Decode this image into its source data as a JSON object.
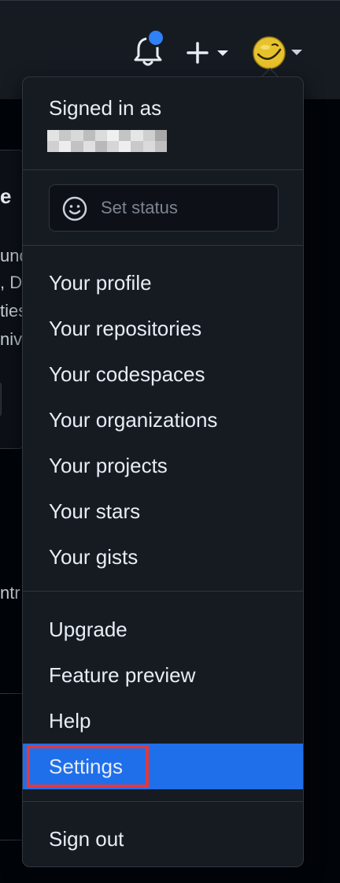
{
  "header": {
    "bell_icon": "bell-icon",
    "notification_indicator": "unread-dot",
    "create_icon": "plus-icon",
    "avatar_icon": "avatar-smiley-icon",
    "accent": "#2f81f7"
  },
  "background_page": {
    "fragments": [
      "e",
      "und",
      ", D",
      "ties",
      "niv",
      "ntr"
    ]
  },
  "menu": {
    "signed_in_label": "Signed in as",
    "status_placeholder": "Set status",
    "section1": [
      "Your profile",
      "Your repositories",
      "Your codespaces",
      "Your organizations",
      "Your projects",
      "Your stars",
      "Your gists"
    ],
    "section2": [
      "Upgrade",
      "Feature preview",
      "Help",
      "Settings"
    ],
    "sign_out": "Sign out",
    "active_item": "Settings",
    "active_color": "#1f6feb",
    "highlight_color": "#e5383b"
  }
}
